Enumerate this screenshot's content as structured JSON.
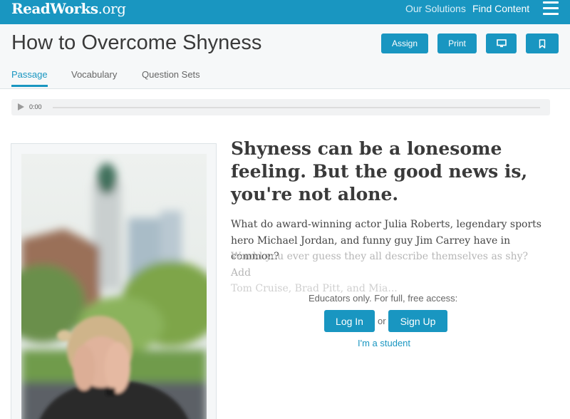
{
  "header": {
    "logo_main": "ReadWorks",
    "logo_suffix": ".org",
    "nav": [
      "Our Solutions",
      "Find Content"
    ],
    "menu_icon": "hamburger-menu-icon"
  },
  "article": {
    "title": "How to Overcome Shyness",
    "actions": {
      "assign": "Assign",
      "print": "Print",
      "present_icon": "monitor-icon",
      "save_icon": "bookmark-icon"
    },
    "tabs": [
      "Passage",
      "Vocabulary",
      "Question Sets"
    ],
    "active_tab": "Passage"
  },
  "audio": {
    "time": "0:00",
    "play_icon": "play-icon"
  },
  "passage": {
    "headline": "Shyness can be a lonesome feeling. But the good news is, you're not alone.",
    "lines": [
      "What do award-winning actor Julia Roberts, legendary sports",
      "hero Michael Jordan, and funny guy Jim Carrey have in common?"
    ],
    "faded_lines": [
      "Would you ever guess they all describe themselves as shy? Add",
      "Tom Cruise, Brad Pitt, and Mia..."
    ]
  },
  "access": {
    "note": "Educators only. For full, free access:",
    "login": "Log In",
    "or": "or",
    "signup": "Sign Up",
    "student": "I'm a student"
  },
  "colors": {
    "brand": "#1996c1",
    "title_bg": "#f6f8f9"
  }
}
